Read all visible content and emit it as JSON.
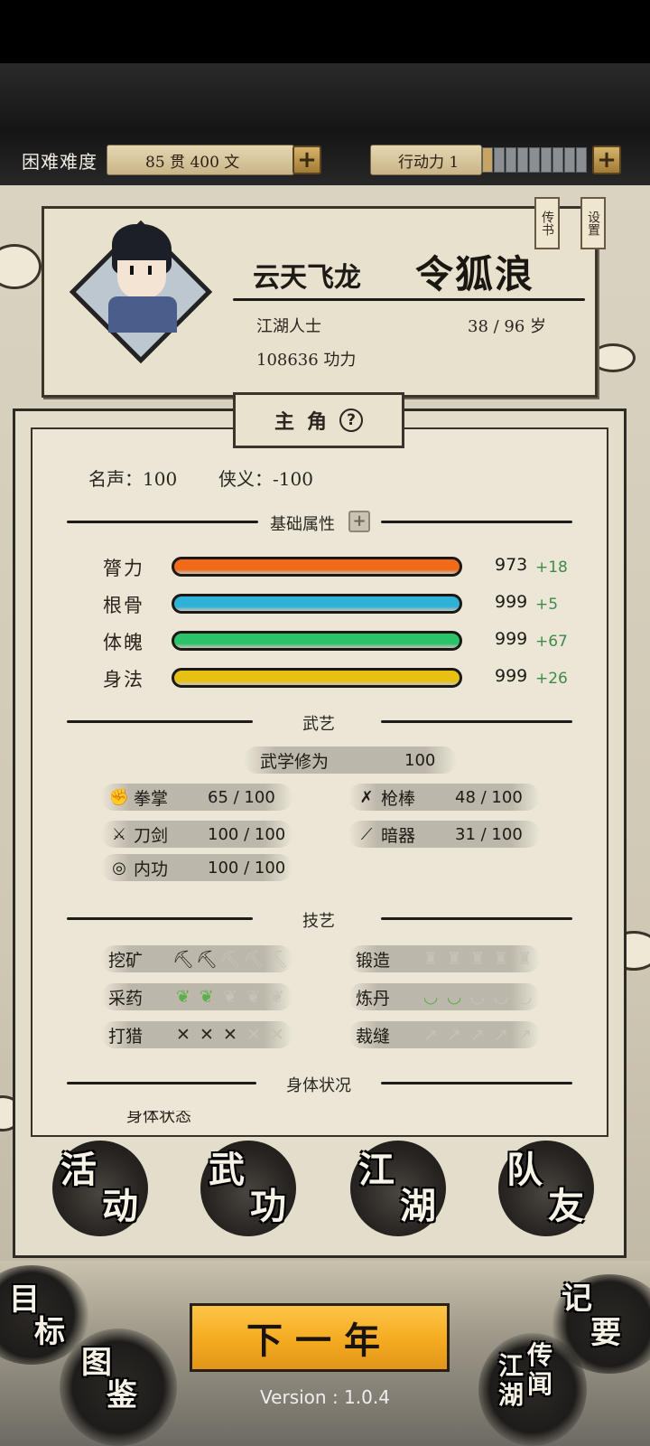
{
  "difficulty_label": "困难难度",
  "money": {
    "amount": "85 贯 400 文"
  },
  "action_power": {
    "label": "行动力 1",
    "filled": 1,
    "total": 9
  },
  "tags": {
    "chuanshu": "传书",
    "settings": "设置"
  },
  "profile": {
    "title": "云天飞龙",
    "name": "令狐浪",
    "identity": "江湖人士",
    "age": "38 / 96 岁",
    "power": "108636 功力"
  },
  "section_tab": {
    "label": "主角",
    "help": "?"
  },
  "reputation": {
    "fame": "名声：100",
    "chivalry": "侠义：-100"
  },
  "headers": {
    "basic_attrs": "基础属性",
    "martial": "武艺",
    "crafts": "技艺",
    "body": "身体状况"
  },
  "attributes": [
    {
      "label": "膂力",
      "value": "973",
      "bonus": "+18",
      "color": "#f06a1a"
    },
    {
      "label": "根骨",
      "value": "999",
      "bonus": "+5",
      "color": "#2fb2d8"
    },
    {
      "label": "体魄",
      "value": "999",
      "bonus": "+67",
      "color": "#2bc36a"
    },
    {
      "label": "身法",
      "value": "999",
      "bonus": "+26",
      "color": "#e8c010"
    }
  ],
  "martial_cultivation": {
    "label": "武学修为",
    "value": "100"
  },
  "martial_skills": [
    {
      "label": "拳掌",
      "value": "65 / 100",
      "icon": "fist-icon"
    },
    {
      "label": "枪棒",
      "value": "48 / 100",
      "icon": "spear-icon"
    },
    {
      "label": "刀剑",
      "value": "100 / 100",
      "icon": "sword-icon"
    },
    {
      "label": "暗器",
      "value": "31 / 100",
      "icon": "dart-icon"
    },
    {
      "label": "内功",
      "value": "100 / 100",
      "icon": "inner-power-icon"
    }
  ],
  "crafts": [
    {
      "label": "挖矿",
      "level": 2,
      "max": 5,
      "icon": "pickaxe-icon"
    },
    {
      "label": "锻造",
      "level": 0,
      "max": 5,
      "icon": "anvil-icon"
    },
    {
      "label": "采药",
      "level": 2,
      "max": 5,
      "icon": "herb-icon"
    },
    {
      "label": "炼丹",
      "level": 2,
      "max": 5,
      "icon": "bowl-icon"
    },
    {
      "label": "打猎",
      "level": 3,
      "max": 5,
      "icon": "bow-icon"
    },
    {
      "label": "裁缝",
      "level": 0,
      "max": 5,
      "icon": "needle-icon"
    }
  ],
  "body_status_cut": "身体状态",
  "nav": [
    {
      "label": "活动",
      "top": "活",
      "bottom": "动"
    },
    {
      "label": "武功",
      "top": "武",
      "bottom": "功"
    },
    {
      "label": "江湖",
      "top": "江",
      "bottom": "湖"
    },
    {
      "label": "队友",
      "top": "队",
      "bottom": "友"
    }
  ],
  "corners": {
    "goal": [
      "目",
      "标"
    ],
    "atlas": [
      "图",
      "鉴"
    ],
    "notes": [
      "记",
      "要"
    ],
    "legend": [
      "江",
      "湖",
      "传",
      "闻"
    ]
  },
  "next_year": "下一年",
  "version": "Version : 1.0.4"
}
